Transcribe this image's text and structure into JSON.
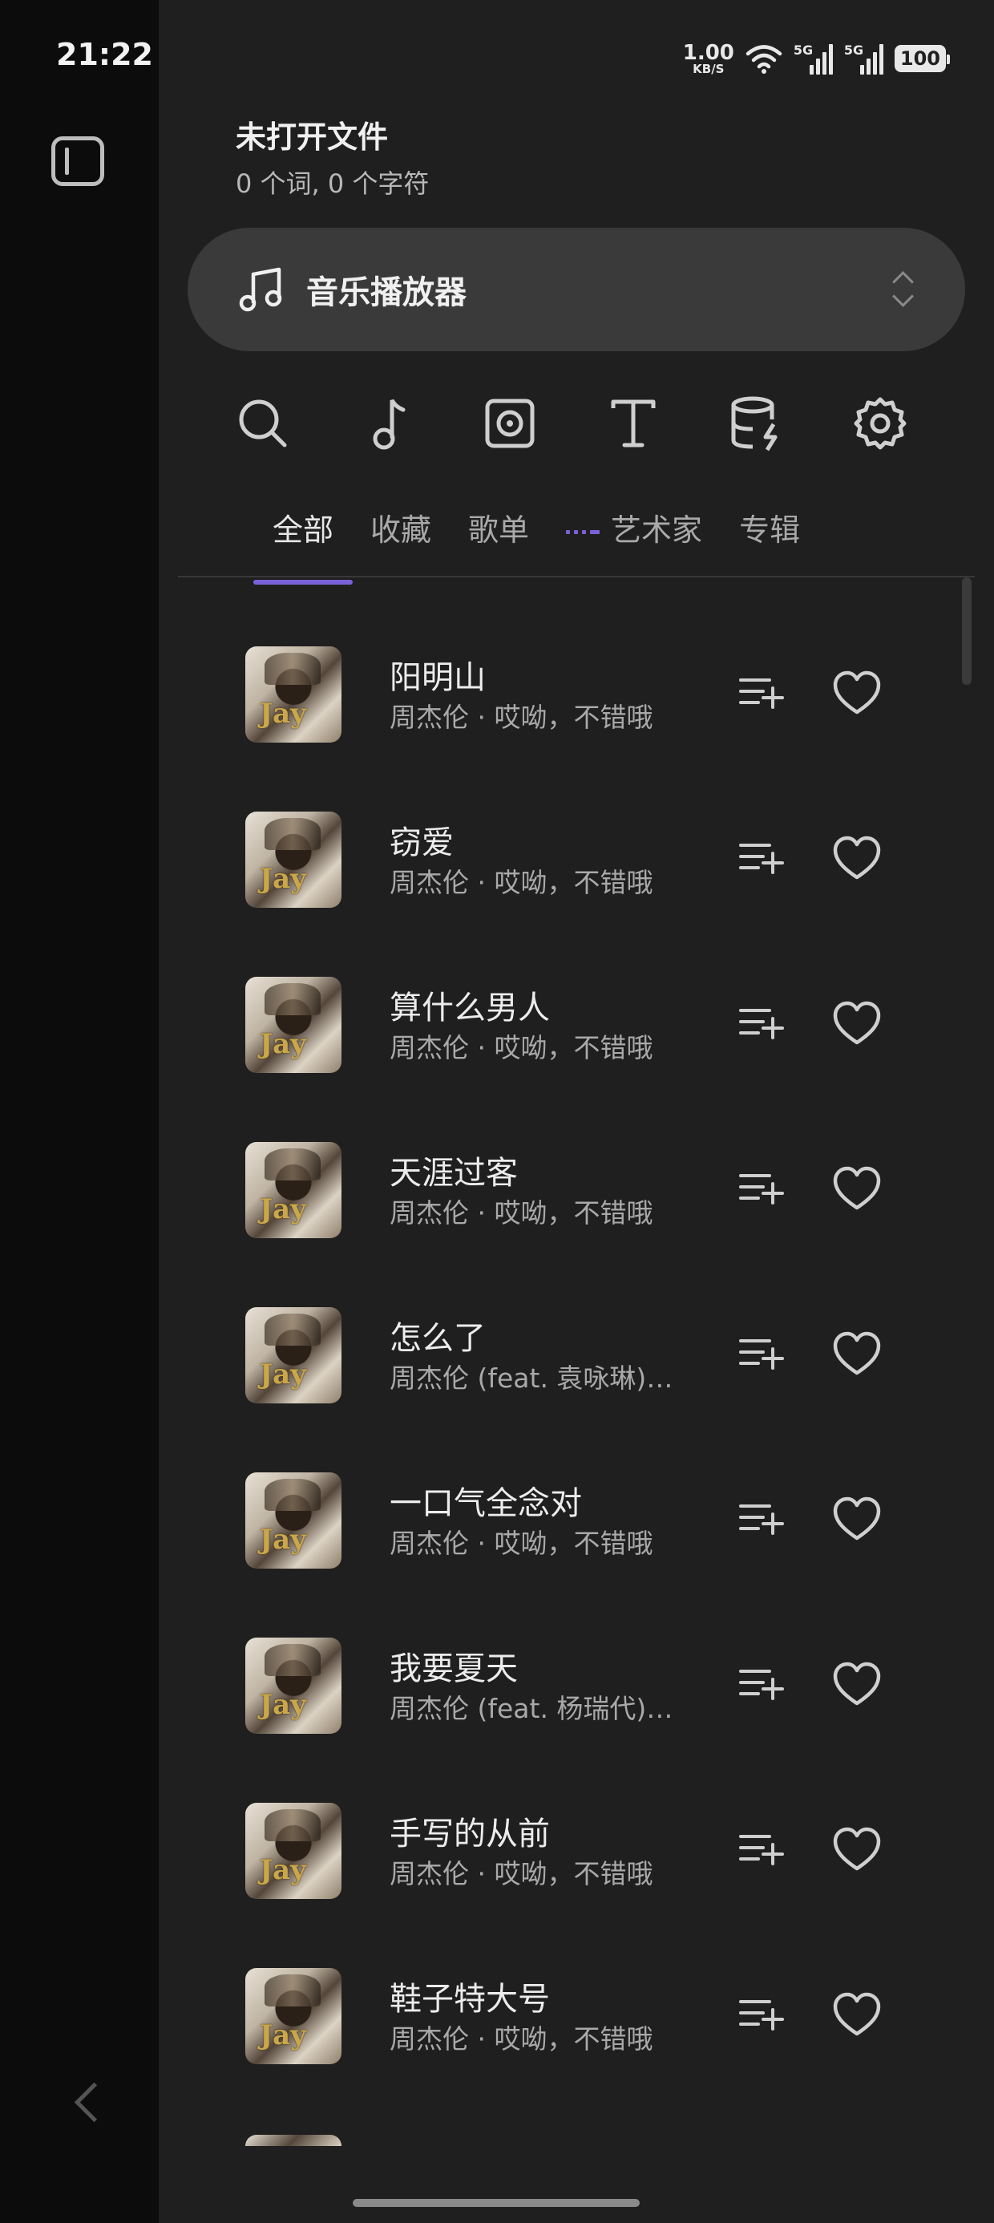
{
  "status": {
    "time": "21:22",
    "net_speed_value": "1.00",
    "net_speed_unit": "KB/S",
    "signal_1_label": "5G",
    "signal_2_label": "5G",
    "battery": "100"
  },
  "header": {
    "file_title": "未打开文件",
    "file_stats": "0 个词, 0 个字符"
  },
  "view_selector": {
    "label": "音乐播放器"
  },
  "toolbar": {
    "icons": [
      "search-icon",
      "music-note-icon",
      "disc-icon",
      "text-icon",
      "database-icon",
      "gear-icon"
    ]
  },
  "tabs": [
    {
      "label": "全部",
      "active": true
    },
    {
      "label": "收藏",
      "active": false
    },
    {
      "label": "歌单",
      "active": false
    },
    {
      "label": "艺术家",
      "active": false
    },
    {
      "label": "专辑",
      "active": false
    }
  ],
  "songs": [
    {
      "title": "阳明山",
      "subtitle": "周杰伦 · 哎呦，不错哦"
    },
    {
      "title": "窃爱",
      "subtitle": "周杰伦 · 哎呦，不错哦"
    },
    {
      "title": "算什么男人",
      "subtitle": "周杰伦 · 哎呦，不错哦"
    },
    {
      "title": "天涯过客",
      "subtitle": "周杰伦 · 哎呦，不错哦"
    },
    {
      "title": "怎么了",
      "subtitle": "周杰伦 (feat. 袁咏琳) ..."
    },
    {
      "title": "一口气全念对",
      "subtitle": "周杰伦 · 哎呦，不错哦"
    },
    {
      "title": "我要夏天",
      "subtitle": "周杰伦 (feat. 杨瑞代) ..."
    },
    {
      "title": "手写的从前",
      "subtitle": "周杰伦 · 哎呦，不错哦"
    },
    {
      "title": "鞋子特大号",
      "subtitle": "周杰伦 · 哎呦，不错哦"
    }
  ],
  "colors": {
    "accent": "#7b61d9",
    "background": "#1f1f1f",
    "rail": "#0c0c0c",
    "pill": "#3a3a3a"
  }
}
